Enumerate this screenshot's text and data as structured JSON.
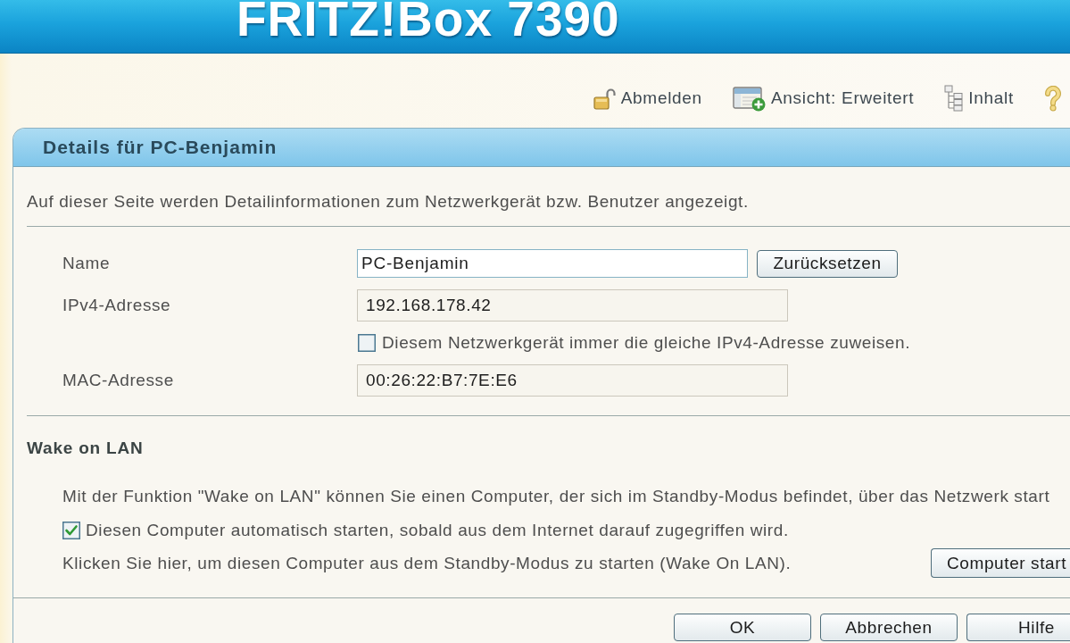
{
  "header": {
    "logo": "FRITZ!Box 7390"
  },
  "toolbar": [
    {
      "kind": "logout",
      "label": "Abmelden"
    },
    {
      "kind": "view",
      "label": "Ansicht: Erweitert"
    },
    {
      "kind": "contents",
      "label": "Inhalt"
    },
    {
      "kind": "help"
    }
  ],
  "panel": {
    "title": "Details für PC-Benjamin",
    "intro": "Auf dieser Seite werden Detailinformationen zum Netzwerkgerät bzw. Benutzer angezeigt.",
    "fields": [
      {
        "kind": "input",
        "label": "Name",
        "value": "PC-Benjamin",
        "button": "Zurücksetzen"
      },
      {
        "kind": "readonly",
        "label": "IPv4-Adresse",
        "value": "192.168.178.42"
      },
      {
        "kind": "checkbox",
        "label": "Diesem Netzwerkgerät immer die gleiche IPv4-Adresse zuweisen.",
        "checked": false
      },
      {
        "kind": "readonly",
        "label": "MAC-Adresse",
        "value": "00:26:22:B7:7E:E6"
      }
    ],
    "wake_on_lan": {
      "heading": "Wake on LAN",
      "description": "Mit der Funktion \"Wake on LAN\" können Sie einen Computer, der sich im Standby-Modus befindet, über das Netzwerk start",
      "auto_start": {
        "label": "Diesen Computer automatisch starten, sobald aus dem Internet darauf zugegriffen wird.",
        "checked": true
      },
      "hint": "Klicken Sie hier, um diesen Computer aus dem Standby-Modus zu starten (Wake On LAN).",
      "button": "Computer start"
    }
  },
  "buttons": [
    "OK",
    "Abbrechen",
    "Hilfe"
  ]
}
